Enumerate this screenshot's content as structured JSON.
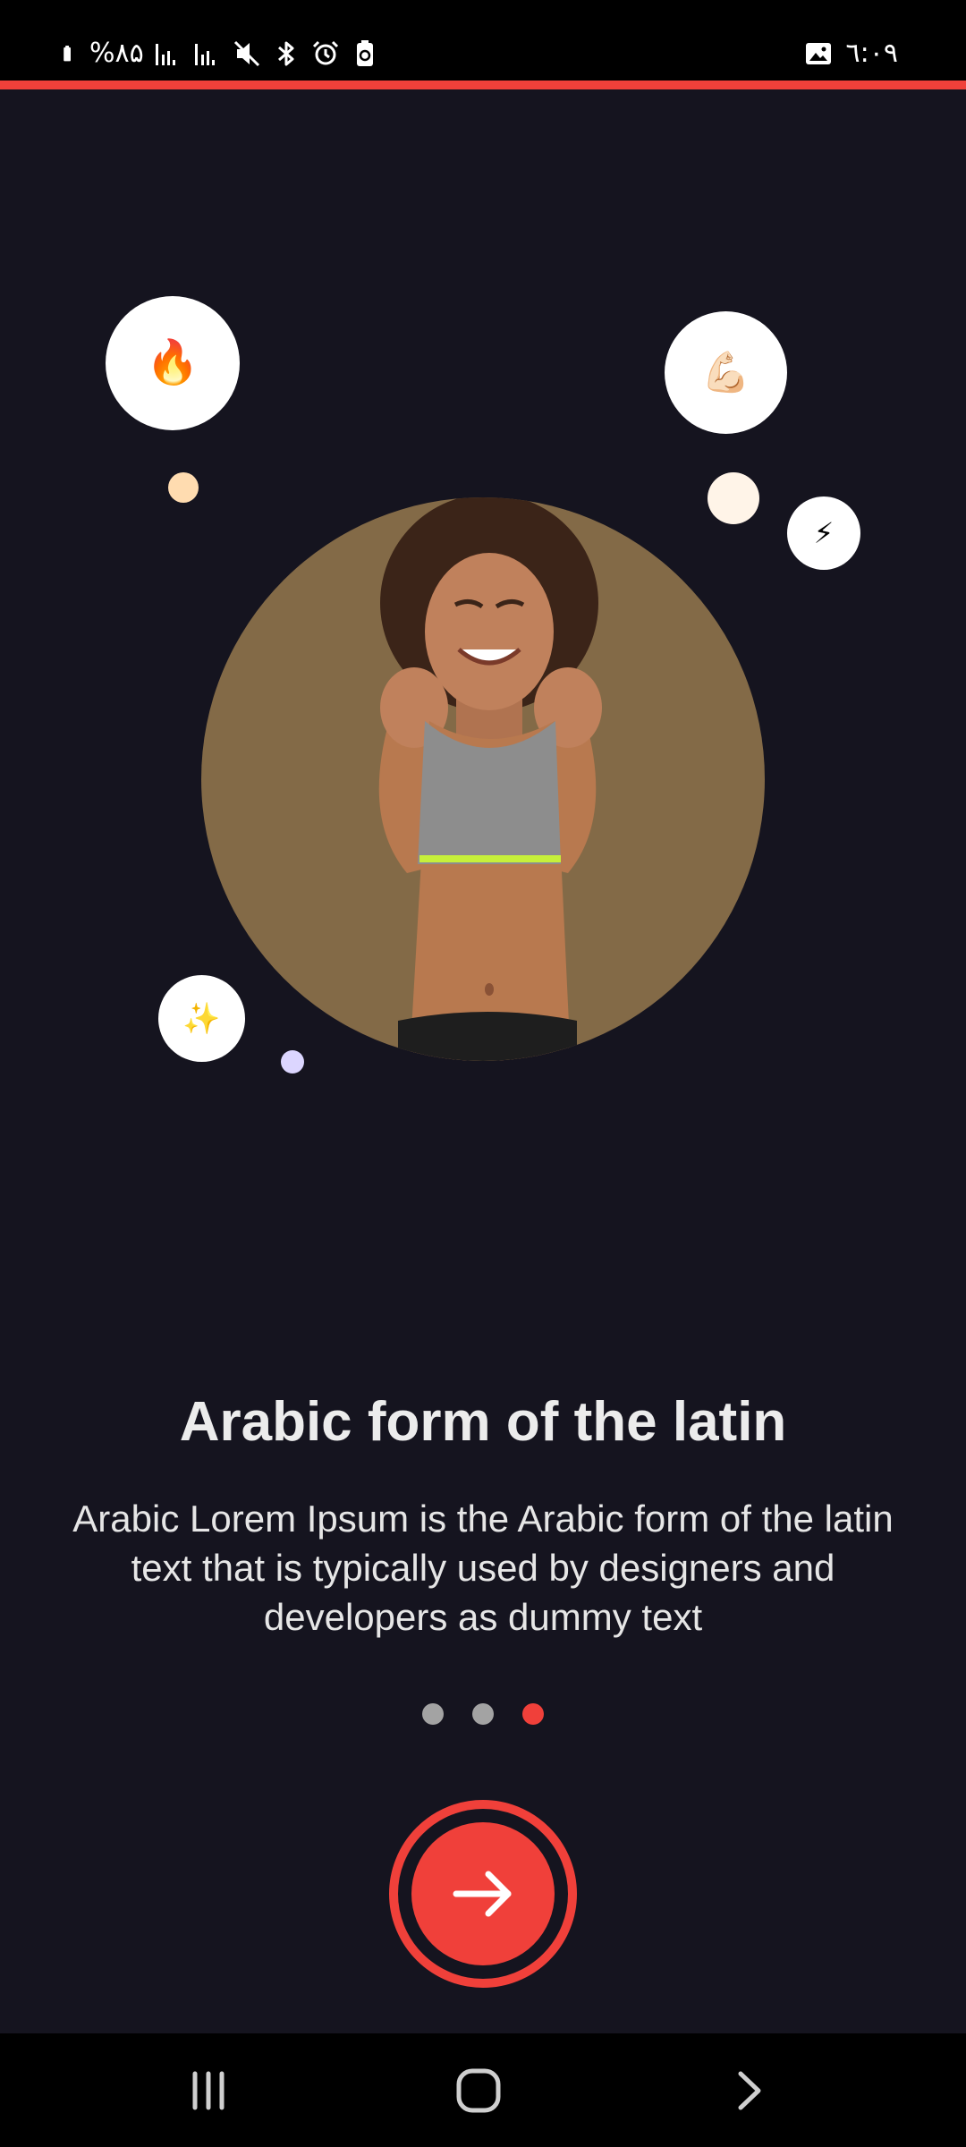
{
  "status_bar": {
    "battery_percent": "%۸۵",
    "time": "٦:٠٩",
    "icons": [
      "battery-icon",
      "signal-1-icon",
      "signal-2-icon",
      "mute-icon",
      "bluetooth-icon",
      "alarm-icon",
      "battery-saver-icon",
      "gallery-icon"
    ]
  },
  "colors": {
    "accent": "#f0403a",
    "background": "#15141f",
    "hero_circle": "#836a47"
  },
  "hero": {
    "bubbles": [
      {
        "name": "fire-icon",
        "glyph": "🔥"
      },
      {
        "name": "flexed-bicep-icon",
        "glyph": "💪🏻"
      },
      {
        "name": "lightning-icon",
        "glyph": "⚡"
      },
      {
        "name": "sparkles-icon",
        "glyph": "✨"
      }
    ]
  },
  "onboarding": {
    "title": "Arabic form of the latin",
    "description": "Arabic Lorem Ipsum is the Arabic form of the latin text that is typically used by designers and developers as dummy text"
  },
  "pager": {
    "pages": 3,
    "current": 3
  },
  "next_button": {
    "icon": "arrow-right-icon"
  },
  "nav_bar": {
    "icons": [
      "recents-icon",
      "home-icon",
      "back-icon"
    ]
  }
}
